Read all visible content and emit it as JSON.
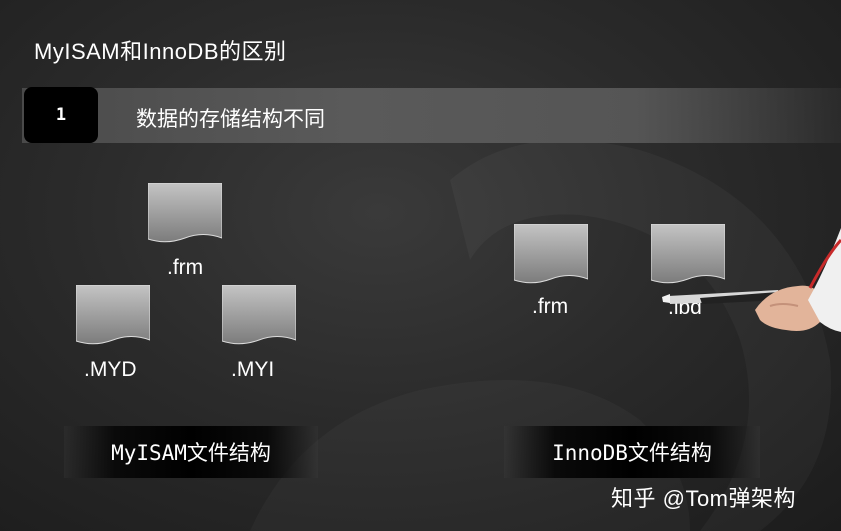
{
  "slide": {
    "title": "MyISAM和InnoDB的区别"
  },
  "section": {
    "number": "1",
    "heading": "数据的存储结构不同"
  },
  "myisam": {
    "files": [
      ".frm",
      ".MYD",
      ".MYI"
    ],
    "caption": "MyISAM文件结构"
  },
  "innodb": {
    "files": [
      ".frm",
      ".ibd"
    ],
    "caption": "InnoDB文件结构"
  },
  "watermark": "知乎 @Tom弹架构",
  "colors": {
    "background": "#2b2b2b",
    "number_box": "#000000",
    "file_icon": "#9a9a9a"
  },
  "icons": {
    "file": "document-icon",
    "pointer": "laser-pointer-icon"
  }
}
